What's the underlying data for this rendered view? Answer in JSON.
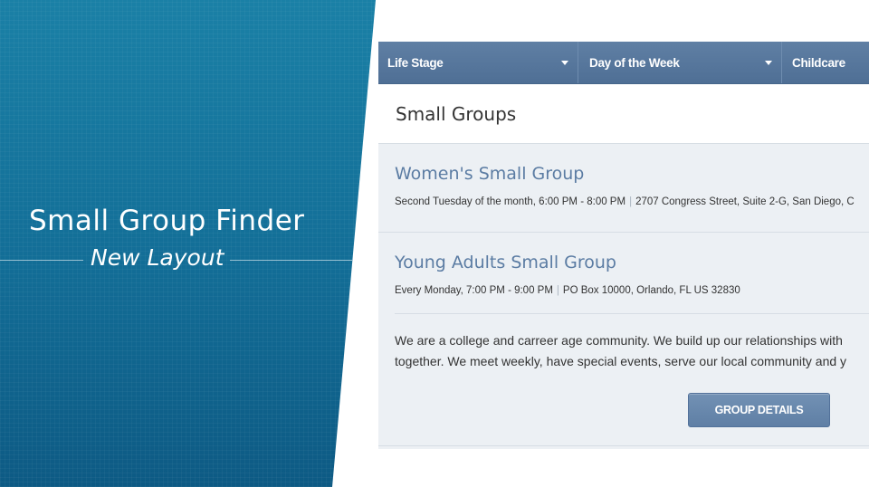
{
  "hero": {
    "title": "Small Group Finder",
    "subtitle": "New Layout"
  },
  "filters": [
    {
      "label": "Life Stage"
    },
    {
      "label": "Day of the Week"
    },
    {
      "label": "Childcare"
    }
  ],
  "section": {
    "title": "Small Groups"
  },
  "groups": [
    {
      "name": "Women's Small Group",
      "schedule": "Second Tuesday of the month, 6:00 PM - 8:00 PM",
      "location": "2707 Congress Street, Suite 2-G, San Diego, C"
    },
    {
      "name": "Young Adults Small Group",
      "schedule": "Every Monday, 7:00 PM - 9:00 PM",
      "location": "PO Box 10000, Orlando, FL US 32830",
      "description_line1": "We are a college and carreer age community. We build up our relationships with",
      "description_line2": "together. We meet weekly, have special events, serve our local community and y",
      "details_label": "GROUP DETAILS"
    }
  ],
  "colors": {
    "hero_blue": "#136f98",
    "filter_bar": "#5a7aa0",
    "group_link": "#5b7ca3",
    "button": "#6887ab"
  }
}
